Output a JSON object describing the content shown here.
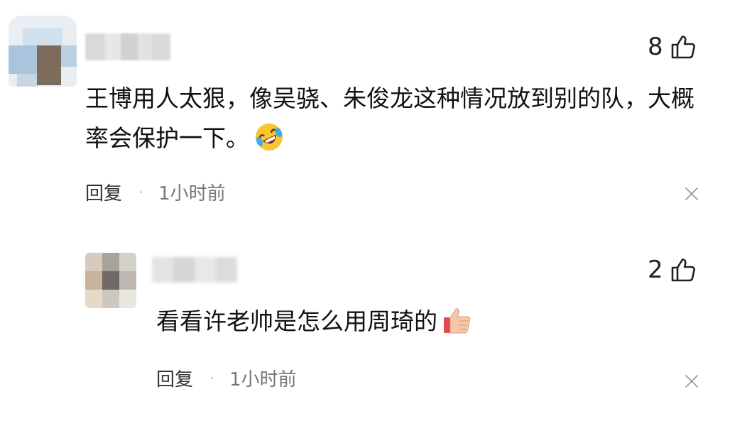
{
  "comments": [
    {
      "likes": "8",
      "text": "王博用人太狠，像吴骁、朱俊龙这种情况放到别的队，大概率会保护一下。",
      "emoji": "rolling-on-floor-laughing-emoji",
      "reply_label": "回复",
      "separator": "·",
      "time": "1小时前"
    },
    {
      "likes": "2",
      "text": "看看许老帅是怎么用周琦的",
      "emoji": "thumbs-up-emoji",
      "reply_label": "回复",
      "separator": "·",
      "time": "1小时前"
    }
  ],
  "colors": {
    "text": "#111111",
    "secondary": "#777777",
    "emoji_yellow": "#F7C630",
    "emoji_tear": "#3FA9F5",
    "thumb_skin": "#F5C8A8",
    "cuff_red": "#E5484D"
  },
  "icons": {
    "like": "thumbs-up-outline-icon",
    "close": "close-icon"
  }
}
